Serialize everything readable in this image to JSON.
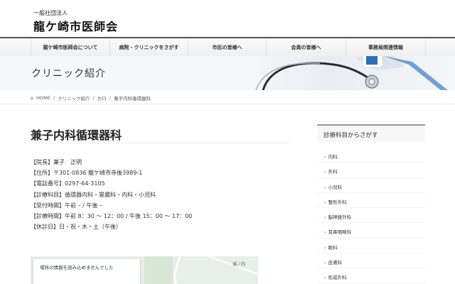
{
  "logo": {
    "sub": "一般社団法人",
    "main": "龍ケ崎市医師会"
  },
  "nav": [
    "龍ケ崎市医師会について",
    "病院・クリニックをさがす",
    "市民の皆様へ",
    "会員の皆様へ",
    "事務局関連情報"
  ],
  "hero": {
    "title": "クリニック紹介"
  },
  "breadcrumb": [
    "HOME",
    "/",
    "クリニック紹介",
    "/",
    "か行",
    "/",
    "兼子内科循環器科"
  ],
  "page": {
    "title": "兼子内科循環器科",
    "info": [
      "【院長】兼子　正明",
      "【住所】〒301-0836 龍ケ崎市寺後3989-1",
      "【電話番号】0297-64-3105",
      "【診療科目】循環器内科・胃腸科・内科・小児科",
      "【受付時間】午前 – / 午後 –",
      "【診療時間】午前 8：30 ～ 12：00 / 午後 15：00 ～ 17：00",
      "【休診日】日・祝・木・土（午後）"
    ]
  },
  "map": {
    "message": "場所の情報を読み込めませんでした",
    "label": "城ノ内"
  },
  "sidebar": {
    "heading": "診療科目からさがす",
    "items": [
      "内科",
      "外科",
      "小児科",
      "整形外科",
      "脳神経外科",
      "耳鼻咽喉科",
      "眼科",
      "皮膚科",
      "形成外科"
    ]
  }
}
